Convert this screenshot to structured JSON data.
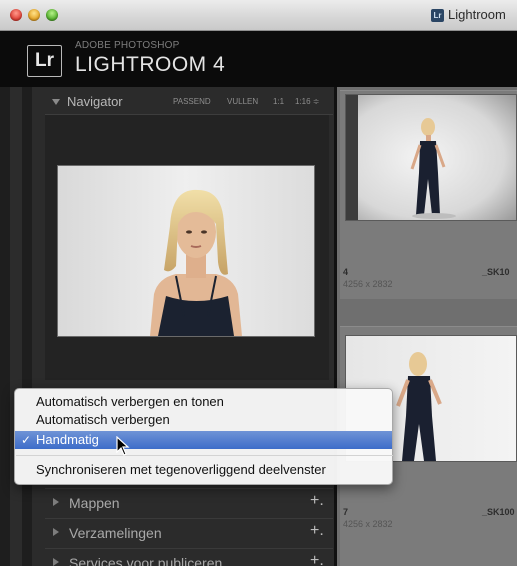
{
  "window": {
    "app_title": "Lightroom",
    "app_icon": "lightroom-app-icon"
  },
  "identity_plate": {
    "logo": "Lr",
    "small": "ADOBE PHOTOSHOP",
    "big": "LIGHTROOM 4"
  },
  "navigator": {
    "title": "Navigator",
    "zoom_options": [
      "PASSEND",
      "VULLEN",
      "1:1",
      "1:16 ≑"
    ]
  },
  "grid": {
    "cells": [
      {
        "number": "4",
        "dimensions": "4256 x 2832",
        "filename": "_SK10"
      },
      {
        "number": "7",
        "dimensions": "4256 x 2832",
        "filename": "_SK100"
      }
    ]
  },
  "panels": [
    {
      "label": "Mappen",
      "action": "+."
    },
    {
      "label": "Verzamelingen",
      "action": "+."
    },
    {
      "label": "Services voor publiceren",
      "action": "+."
    }
  ],
  "context_menu": {
    "items": [
      {
        "label": "Automatisch verbergen en tonen"
      },
      {
        "label": "Automatisch verbergen"
      },
      {
        "label": "Handmatig",
        "check": "✓"
      },
      {
        "label": "Synchroniseren met tegenoverliggend deelvenster"
      }
    ]
  }
}
